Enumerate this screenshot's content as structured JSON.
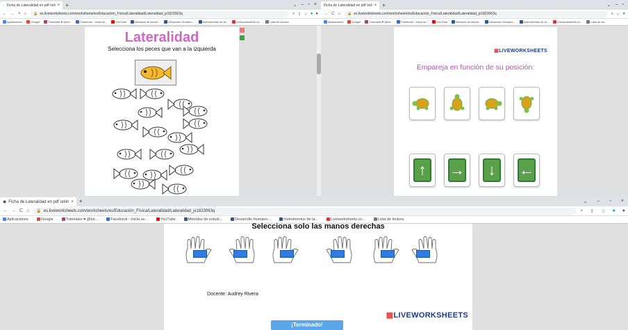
{
  "win1": {
    "tab_title": "Ficha de Lateralidad en pdf onli",
    "url": "es.liveworksheets.com/worksheets/es/Educación_Física/Lateralidad/Lateralidad_jx1823063q",
    "bookmarks": [
      "Aplicaciones",
      "Google",
      "Tutoriales ♥ @tut...",
      "Facebook - Inicia se...",
      "YouTube",
      "Metodos de estudi...",
      "Desarrollo Humano...",
      "Instrumentos de la...",
      "Liveworksheets.co...",
      "Lista de lectura"
    ],
    "page_title": "Lateralidad",
    "subtitle": "Selecciona los peces que van a la izquierda"
  },
  "win2": {
    "tab_title": "Ficha de Lateralidad en pdf onli",
    "url": "es.liveworksheets.com/worksheets/es/Educación_Física/Lateralidad/Lateralidad_jx1823063q",
    "bookmarks": [
      "Aplicaciones",
      "Google",
      "Tutoriales ♥ @tut...",
      "Facebook - Inicia se...",
      "YouTube",
      "Metodos de estudi...",
      "Desarrollo Humano...",
      "Instrumentos de la...",
      "Liveworksheets.co...",
      "Lista de lec"
    ],
    "logo": "LIVEWORKSHEETS",
    "heading": "Empareja en función de su posición:",
    "arrows": [
      "↑",
      "→",
      "↓",
      "←"
    ]
  },
  "win3": {
    "tab_title": "Ficha de Lateralidad en pdf onlin",
    "url": "es.liveworksheets.com/worksheets/es/Educación_Física/Lateralidad/Lateralidad_jx1823063q",
    "bookmarks": [
      "Aplicaciones",
      "Google",
      "Tutoriales ♥ @tut...",
      "Facebook - Inicia se...",
      "YouTube",
      "Metodos de estudi...",
      "Desarrollo Humano...",
      "Instrumentos de la...",
      "Liveworksheets.co...",
      "Lista de lectura"
    ],
    "heading": "Selecciona solo las manos derechas",
    "teacher": "Docente: Audrey Rivera",
    "logo": "LIVEWORKSHEETS",
    "finish_button": "¡Terminado!"
  },
  "colors": {
    "accent_pink": "#d066c8",
    "green": "#5aa04a",
    "blue": "#2f7de1",
    "finish": "#5aa6e8"
  }
}
